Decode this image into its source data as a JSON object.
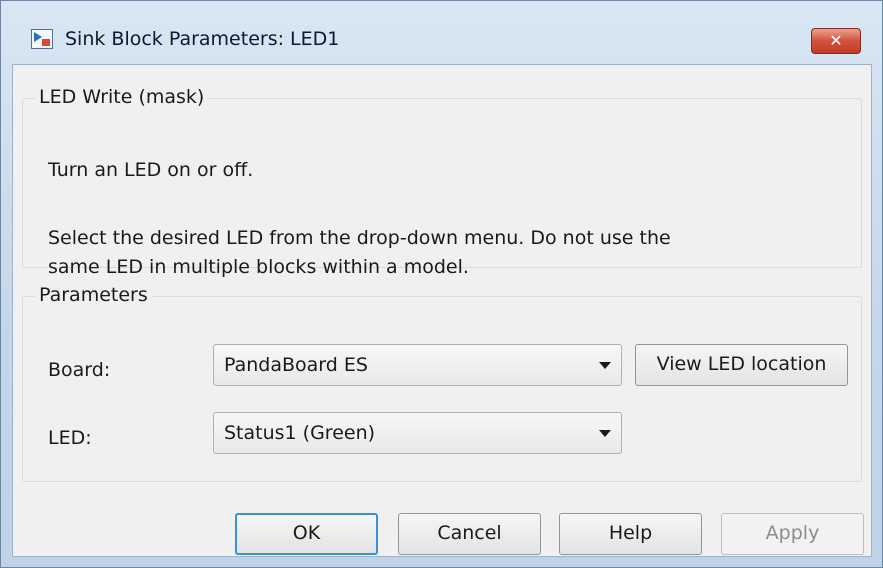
{
  "window": {
    "title": "Sink Block Parameters: LED1",
    "close_glyph": "✕"
  },
  "description_group": {
    "title": "LED Write (mask)",
    "line1": "Turn an LED on or off.",
    "line2": "Select the desired LED from the drop-down menu. Do not use the",
    "line3": "same LED in multiple blocks within a model."
  },
  "parameters_group": {
    "title": "Parameters",
    "board_label": "Board:",
    "board_value": "PandaBoard ES",
    "view_led_button": "View LED location",
    "led_label": "LED:",
    "led_value": "Status1 (Green)"
  },
  "buttons": {
    "ok": "OK",
    "cancel": "Cancel",
    "help": "Help",
    "apply": "Apply"
  },
  "colors": {
    "default_button_border": "#3c8fd9",
    "close_button": "#c03a24"
  }
}
